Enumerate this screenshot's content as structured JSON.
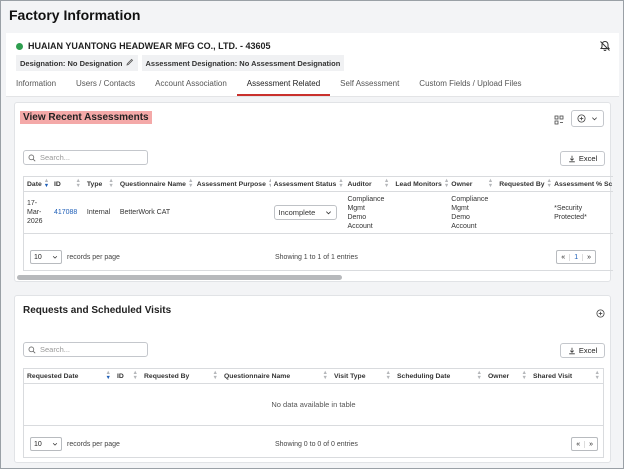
{
  "page": {
    "title": "Factory Information"
  },
  "factory": {
    "name": "HUAIAN YUANTONG HEADWEAR MFG CO., LTD. - 43605",
    "designation": "Designation: No Designation",
    "assessment_designation": "Assessment Designation: No Assessment Designation"
  },
  "tabs": [
    {
      "label": "Information"
    },
    {
      "label": "Users / Contacts"
    },
    {
      "label": "Account Association"
    },
    {
      "label": "Assessment Related",
      "active": true
    },
    {
      "label": "Self Assessment"
    },
    {
      "label": "Custom Fields / Upload Files"
    }
  ],
  "recent": {
    "title": "View Recent Assessments",
    "search_placeholder": "Search...",
    "excel_label": "Excel",
    "columns": [
      "Date",
      "ID",
      "Type",
      "Questionnaire Name",
      "Assessment Purpose",
      "Assessment Status",
      "Auditor",
      "Lead Monitors",
      "Owner",
      "Requested By",
      "Assessment % Sc"
    ],
    "row": {
      "date": "17-\nMar-\n2026",
      "id": "417088",
      "type": "Internal",
      "questionnaire": "BetterWork CAT",
      "purpose": "",
      "status": "Incomplete",
      "auditor": "Compliance\nMgmt\nDemo\nAccount",
      "lead_monitors": "",
      "owner": "Compliance\nMgmt\nDemo\nAccount",
      "requested_by": "",
      "score": "*Security\nProtected*"
    },
    "page_size": "10",
    "records_per_page": "records per page",
    "showing": "Showing 1 to 1 of 1 entries",
    "pager": {
      "prev": "«",
      "current": "1",
      "next": "»"
    }
  },
  "requests": {
    "title": "Requests and Scheduled Visits",
    "search_placeholder": "Search...",
    "excel_label": "Excel",
    "columns": [
      "Requested Date",
      "ID",
      "Requested By",
      "Questionnaire Name",
      "Visit Type",
      "Scheduling Date",
      "Owner",
      "Shared Visit"
    ],
    "empty": "No data available in table",
    "page_size": "10",
    "records_per_page": "records per page",
    "showing": "Showing 0 to 0 of 0 entries",
    "pager": {
      "prev": "«",
      "next": "»"
    }
  },
  "colors": {
    "accent": "#c9302c",
    "link": "#1f5fb8",
    "status_dot": "#2e9e4f",
    "highlight": "#f4a9a8"
  }
}
